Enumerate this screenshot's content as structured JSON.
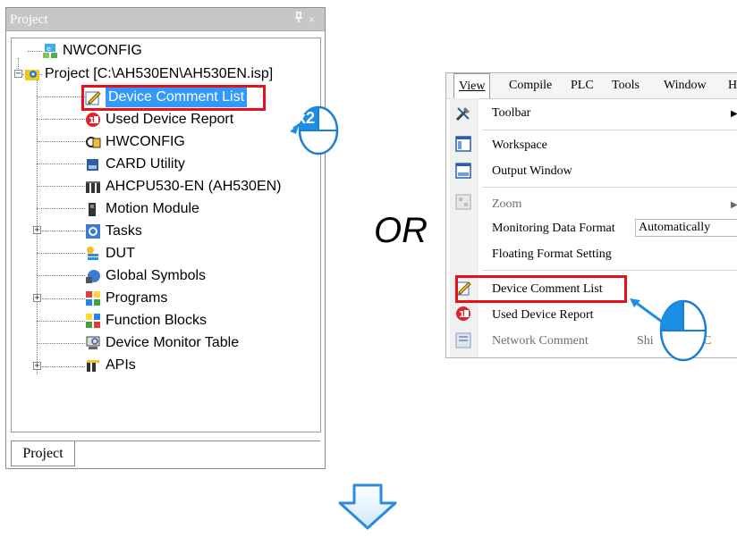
{
  "project_panel": {
    "title": "Project",
    "pin_glyph": "↕",
    "close_glyph": "×",
    "tab_label": "Project",
    "tree": [
      {
        "label": "NWCONFIG",
        "icon": "network-config-icon"
      },
      {
        "label": "Project [C:\\AH530EN\\AH530EN.isp]",
        "icon": "project-gear-icon"
      },
      {
        "label": "Device Comment List",
        "icon": "pencil-note-icon",
        "selected": true
      },
      {
        "label": "Used Device Report",
        "icon": "device-report-icon"
      },
      {
        "label": "HWCONFIG",
        "icon": "hardware-config-icon"
      },
      {
        "label": "CARD Utility",
        "icon": "card-icon"
      },
      {
        "label": "AHCPU530-EN  (AH530EN)",
        "icon": "cpu-module-icon"
      },
      {
        "label": "Motion Module",
        "icon": "module-icon"
      },
      {
        "label": "Tasks",
        "icon": "tasks-icon"
      },
      {
        "label": "DUT",
        "icon": "dut-icon"
      },
      {
        "label": "Global Symbols",
        "icon": "global-symbols-icon"
      },
      {
        "label": "Programs",
        "icon": "programs-icon"
      },
      {
        "label": "Function Blocks",
        "icon": "function-blocks-icon"
      },
      {
        "label": "Device Monitor Table",
        "icon": "monitor-table-icon"
      },
      {
        "label": "APIs",
        "icon": "apis-icon"
      }
    ],
    "double_click_badge": "x2"
  },
  "or_label": "OR",
  "menu": {
    "menubar": [
      "View",
      "Compile",
      "PLC",
      "Tools",
      "Window",
      "H"
    ],
    "items": {
      "toolbar": "Toolbar",
      "workspace": "Workspace",
      "output_window": "Output Window",
      "zoom": "Zoom",
      "monitoring_data_format": "Monitoring Data Format",
      "monitoring_value": "Automatically",
      "floating_format": "Floating Format Setting",
      "device_comment_list": "Device Comment List",
      "used_device_report": "Used Device Report",
      "network_comment": "Network Comment",
      "network_comment_shortcut": "Shi",
      "network_comment_shortcut_tail": "C"
    }
  },
  "colors": {
    "highlight_red": "#e8101c",
    "selection_blue": "#3399ff",
    "arrow_blue": "#1a8fe8",
    "mouse_outline": "#1e7fd0"
  }
}
